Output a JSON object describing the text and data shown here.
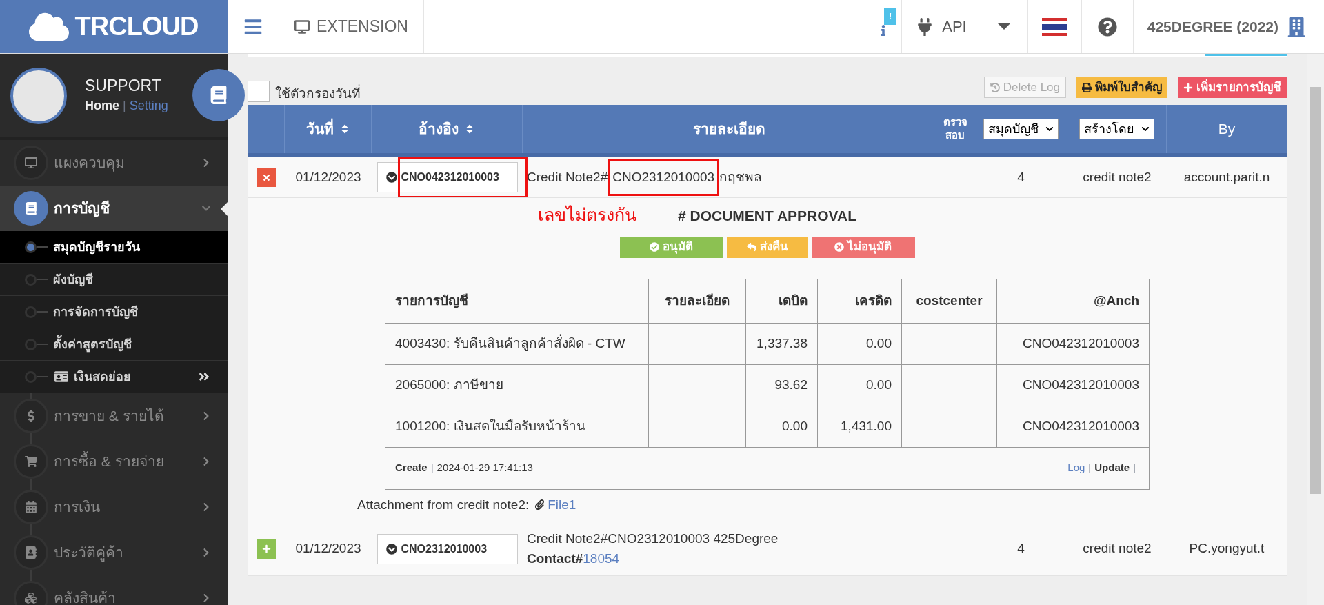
{
  "brand": "TRCLOUD",
  "topbar": {
    "extension": "EXTENSION",
    "info_badge": "!",
    "api": "API",
    "company": "425DEGREE (2022)"
  },
  "profile": {
    "name": "SUPPORT",
    "links": [
      {
        "text": "Home",
        "kind": "label"
      },
      {
        "text": "|",
        "kind": "sep"
      },
      {
        "text": "Setting",
        "kind": "link"
      }
    ]
  },
  "sidebar": {
    "items": [
      {
        "label": "แผงควบคุม",
        "expanded": false,
        "selected": false
      },
      {
        "label": "การบัญชี",
        "expanded": true,
        "selected": true,
        "children": [
          {
            "label": "สมุดบัญชีรายวัน",
            "selected": true,
            "kind": "link"
          },
          {
            "label": "ผังบัญชี",
            "selected": false,
            "kind": "link"
          },
          {
            "label": "การจัดการบัญชี",
            "selected": false,
            "kind": "link"
          },
          {
            "label": "ตั้งค่าสูตรบัญชี",
            "selected": false,
            "kind": "link"
          },
          {
            "label": "เงินสดย่อย",
            "selected": false,
            "kind": "group"
          }
        ]
      },
      {
        "label": "การขาย & รายได้",
        "expanded": false,
        "selected": false
      },
      {
        "label": "การซื้อ & รายจ่าย",
        "expanded": false,
        "selected": false
      },
      {
        "label": "การเงิน",
        "expanded": false,
        "selected": false
      },
      {
        "label": "ประวัติคู่ค้า",
        "expanded": false,
        "selected": false
      },
      {
        "label": "คลังสินค้า",
        "expanded": false,
        "selected": false
      }
    ]
  },
  "filter": {
    "label": "ใช้ตัวกรองวันที่",
    "checked": false
  },
  "actions": [
    {
      "label": "Delete Log",
      "kind": "outline"
    },
    {
      "label": "พิมพ์ใบสำคัญ",
      "kind": "print"
    },
    {
      "label": "เพิ่มรายการบัญชี",
      "kind": "add"
    }
  ],
  "table": {
    "columns": [
      {
        "label": "วันที่",
        "kind": "sort"
      },
      {
        "label": "อ้างอิง",
        "kind": "sort"
      },
      {
        "label": "รายละเอียด",
        "kind": "plain"
      },
      {
        "label": "ตรวจ สอบ",
        "kind": "small"
      },
      {
        "label": "สมุดบัญชี",
        "kind": "select"
      },
      {
        "label": "สร้างโดย",
        "kind": "select"
      },
      {
        "label": "By",
        "kind": "plain"
      }
    ],
    "rows": [
      {
        "expanded": true,
        "date": "01/12/2023",
        "reference": {
          "text": "CNO042312010003",
          "boxed": true
        },
        "detail": [
          {
            "text": "Credit Note2#",
            "boxed": false
          },
          {
            "text": "CNO2312010003",
            "boxed": true
          },
          {
            "text": "กฤชพล",
            "boxed": false
          }
        ],
        "book": "4",
        "creator": "credit note2",
        "by": "account.parit.n",
        "approval": {
          "note": "เลขไม่ตรงกัน",
          "title": "# DOCUMENT APPROVAL",
          "buttons": [
            {
              "label": "อนุมัติ",
              "kind": "approve"
            },
            {
              "label": "ส่งคืน",
              "kind": "return"
            },
            {
              "label": "ไม่อนุมัติ",
              "kind": "reject"
            }
          ],
          "journal": {
            "columns": [
              "รายการบัญชี",
              "รายละเอียด",
              "เดบิต",
              "เครดิต",
              "costcenter",
              "@Anch"
            ],
            "rows": [
              [
                "4003430: รับคืนสินค้าลูกค้าสั่งผิด - CTW",
                "",
                "1,337.38",
                "0.00",
                "",
                "CNO042312010003"
              ],
              [
                "2065000: ภาษีขาย",
                "",
                "93.62",
                "0.00",
                "",
                "CNO042312010003"
              ],
              [
                "1001200: เงินสดในมือรับหน้าร้าน",
                "",
                "0.00",
                "1,431.00",
                "",
                "CNO042312010003"
              ]
            ],
            "footer_left": [
              {
                "text": "Create",
                "kind": "label"
              },
              {
                "text": "|",
                "kind": "sep"
              },
              {
                "text": "2024-01-29 17:41:13",
                "kind": "text"
              }
            ],
            "footer_right": [
              {
                "text": "Log",
                "kind": "link"
              },
              {
                "text": "|",
                "kind": "sep"
              },
              {
                "text": "Update",
                "kind": "label"
              },
              {
                "text": "|",
                "kind": "sep"
              }
            ]
          },
          "attachment": {
            "label": "Attachment from credit note2:",
            "file": "File1"
          }
        }
      },
      {
        "expanded": false,
        "date": "01/12/2023",
        "reference": {
          "text": "CNO2312010003",
          "boxed": false
        },
        "detail": [
          {
            "text": "Credit Note2#CNO2312010003 425Degree",
            "boxed": false
          }
        ],
        "contact": {
          "label": "Contact#",
          "link": "18054"
        },
        "book": "4",
        "creator": "credit note2",
        "by": "PC.yongyut.t"
      }
    ]
  }
}
